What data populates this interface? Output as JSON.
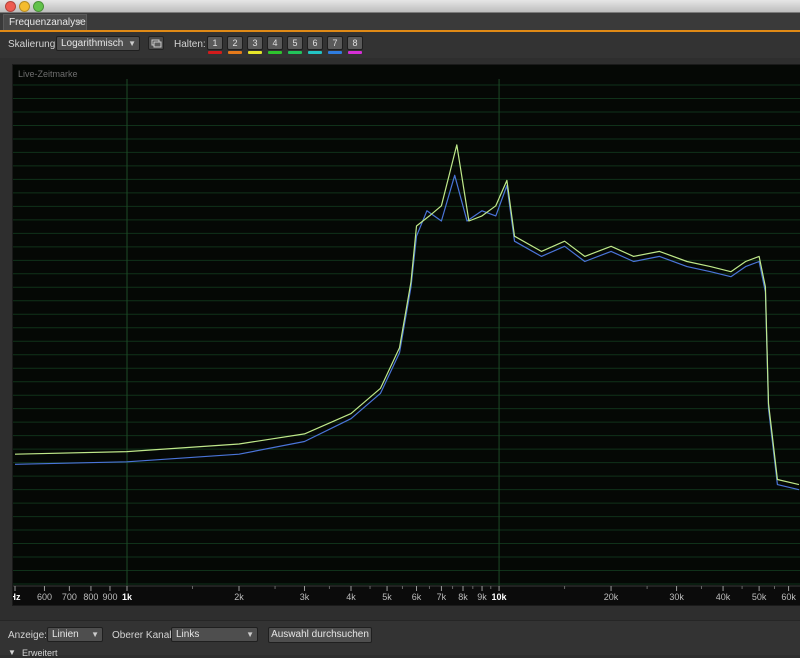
{
  "window": {
    "tab_title": "Frequenzanalyse",
    "tab_close": "×"
  },
  "toolbar": {
    "scaling_label": "Skalierung:",
    "scaling_value": "Logarithmisch",
    "hold_label": "Halten:",
    "hold_buttons": [
      "1",
      "2",
      "3",
      "4",
      "5",
      "6",
      "7",
      "8"
    ],
    "hold_colors": [
      "#d21b1b",
      "#e57a1b",
      "#e6e62a",
      "#2ec52e",
      "#22c45a",
      "#23c4c4",
      "#2f7de0",
      "#d62fd6"
    ]
  },
  "plot": {
    "live_marker": "Live-Zeitmarke"
  },
  "chart_data": {
    "type": "line",
    "xscale": "log",
    "xlim": [
      500,
      64000
    ],
    "x_tick_labels": [
      {
        "hz": 500,
        "text": "Hz"
      },
      {
        "hz": 600,
        "text": "600"
      },
      {
        "hz": 700,
        "text": "700"
      },
      {
        "hz": 800,
        "text": "800"
      },
      {
        "hz": 900,
        "text": "900"
      },
      {
        "hz": 1000,
        "text": "1k"
      },
      {
        "hz": 2000,
        "text": "2k"
      },
      {
        "hz": 3000,
        "text": "3k"
      },
      {
        "hz": 4000,
        "text": "4k"
      },
      {
        "hz": 5000,
        "text": "5k"
      },
      {
        "hz": 6000,
        "text": "6k"
      },
      {
        "hz": 7000,
        "text": "7k"
      },
      {
        "hz": 8000,
        "text": "8k"
      },
      {
        "hz": 9000,
        "text": "9k"
      },
      {
        "hz": 10000,
        "text": "10k"
      },
      {
        "hz": 20000,
        "text": "20k"
      },
      {
        "hz": 30000,
        "text": "30k"
      },
      {
        "hz": 40000,
        "text": "40k"
      },
      {
        "hz": 50000,
        "text": "50k"
      },
      {
        "hz": 60000,
        "text": "60k"
      }
    ],
    "bold_ticks": [
      1000,
      10000
    ],
    "vertical_gridlines_hz": [
      1000,
      10000
    ],
    "horizontal_gridlines": 38,
    "level_scale": [
      0,
      100
    ],
    "series": [
      {
        "color": "#4a74d8",
        "points": [
          [
            500,
            24
          ],
          [
            1000,
            24.5
          ],
          [
            2000,
            26
          ],
          [
            3000,
            28.5
          ],
          [
            4000,
            33
          ],
          [
            4800,
            38
          ],
          [
            5400,
            46
          ],
          [
            5800,
            59
          ],
          [
            6000,
            69
          ],
          [
            6400,
            74
          ],
          [
            7000,
            72
          ],
          [
            7600,
            81
          ],
          [
            8200,
            72
          ],
          [
            9000,
            74
          ],
          [
            9800,
            73
          ],
          [
            10500,
            79
          ],
          [
            11000,
            68
          ],
          [
            13000,
            65
          ],
          [
            15000,
            67
          ],
          [
            17000,
            64
          ],
          [
            20000,
            66
          ],
          [
            23000,
            64
          ],
          [
            27000,
            65
          ],
          [
            32000,
            63
          ],
          [
            37000,
            62
          ],
          [
            42000,
            61
          ],
          [
            46000,
            63
          ],
          [
            50000,
            64
          ],
          [
            52000,
            58
          ],
          [
            53000,
            35
          ],
          [
            56000,
            20
          ],
          [
            64000,
            19
          ]
        ]
      },
      {
        "color": "#bfe88a",
        "points": [
          [
            500,
            26
          ],
          [
            1000,
            26.5
          ],
          [
            2000,
            28
          ],
          [
            3000,
            30
          ],
          [
            4000,
            34
          ],
          [
            4800,
            39
          ],
          [
            5400,
            47
          ],
          [
            5800,
            60
          ],
          [
            6000,
            71
          ],
          [
            6500,
            73
          ],
          [
            7000,
            75
          ],
          [
            7700,
            87
          ],
          [
            8300,
            72
          ],
          [
            9000,
            73
          ],
          [
            9800,
            75
          ],
          [
            10500,
            80
          ],
          [
            11000,
            69
          ],
          [
            13000,
            66
          ],
          [
            15000,
            68
          ],
          [
            17000,
            65
          ],
          [
            20000,
            67
          ],
          [
            23000,
            65
          ],
          [
            27000,
            66
          ],
          [
            32000,
            64
          ],
          [
            37000,
            63
          ],
          [
            42000,
            62
          ],
          [
            46000,
            64
          ],
          [
            50000,
            65
          ],
          [
            52000,
            59
          ],
          [
            53000,
            36
          ],
          [
            56000,
            21
          ],
          [
            64000,
            20
          ]
        ]
      }
    ]
  },
  "bottom": {
    "display_label": "Anzeige:",
    "display_value": "Linien",
    "channel_label": "Oberer Kanal:",
    "channel_value": "Links",
    "search_button": "Auswahl durchsuchen",
    "expand_label": "Erweitert"
  }
}
